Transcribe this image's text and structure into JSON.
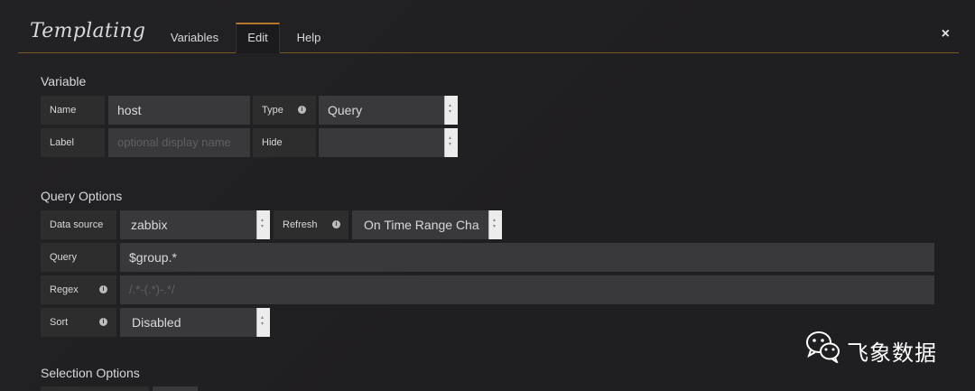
{
  "header": {
    "title": "Templating",
    "tabs": [
      "Variables",
      "Edit",
      "Help"
    ],
    "active_tab": "Edit",
    "close_icon": "×"
  },
  "variable": {
    "heading": "Variable",
    "name_label": "Name",
    "name_value": "host",
    "type_label": "Type",
    "type_value": "Query",
    "label_label": "Label",
    "label_placeholder": "optional display name",
    "hide_label": "Hide",
    "hide_value": ""
  },
  "query_options": {
    "heading": "Query Options",
    "datasource_label": "Data source",
    "datasource_value": "zabbix",
    "refresh_label": "Refresh",
    "refresh_value": "On Time Range Cha",
    "query_label": "Query",
    "query_value": "$group.*",
    "regex_label": "Regex",
    "regex_placeholder": "/.*-(.*)-.*/",
    "sort_label": "Sort",
    "sort_value": "Disabled"
  },
  "selection_options": {
    "heading": "Selection Options"
  },
  "watermark": {
    "text": "飞象数据"
  },
  "colors": {
    "background": "#1f1e20",
    "label_bg": "#2d2d2e",
    "field_bg": "#39393b",
    "accent": "#b5762a"
  },
  "icons": {
    "info": "info-icon",
    "dropdown": "chevron-updown-icon",
    "close": "close-icon",
    "wechat": "wechat-icon"
  }
}
